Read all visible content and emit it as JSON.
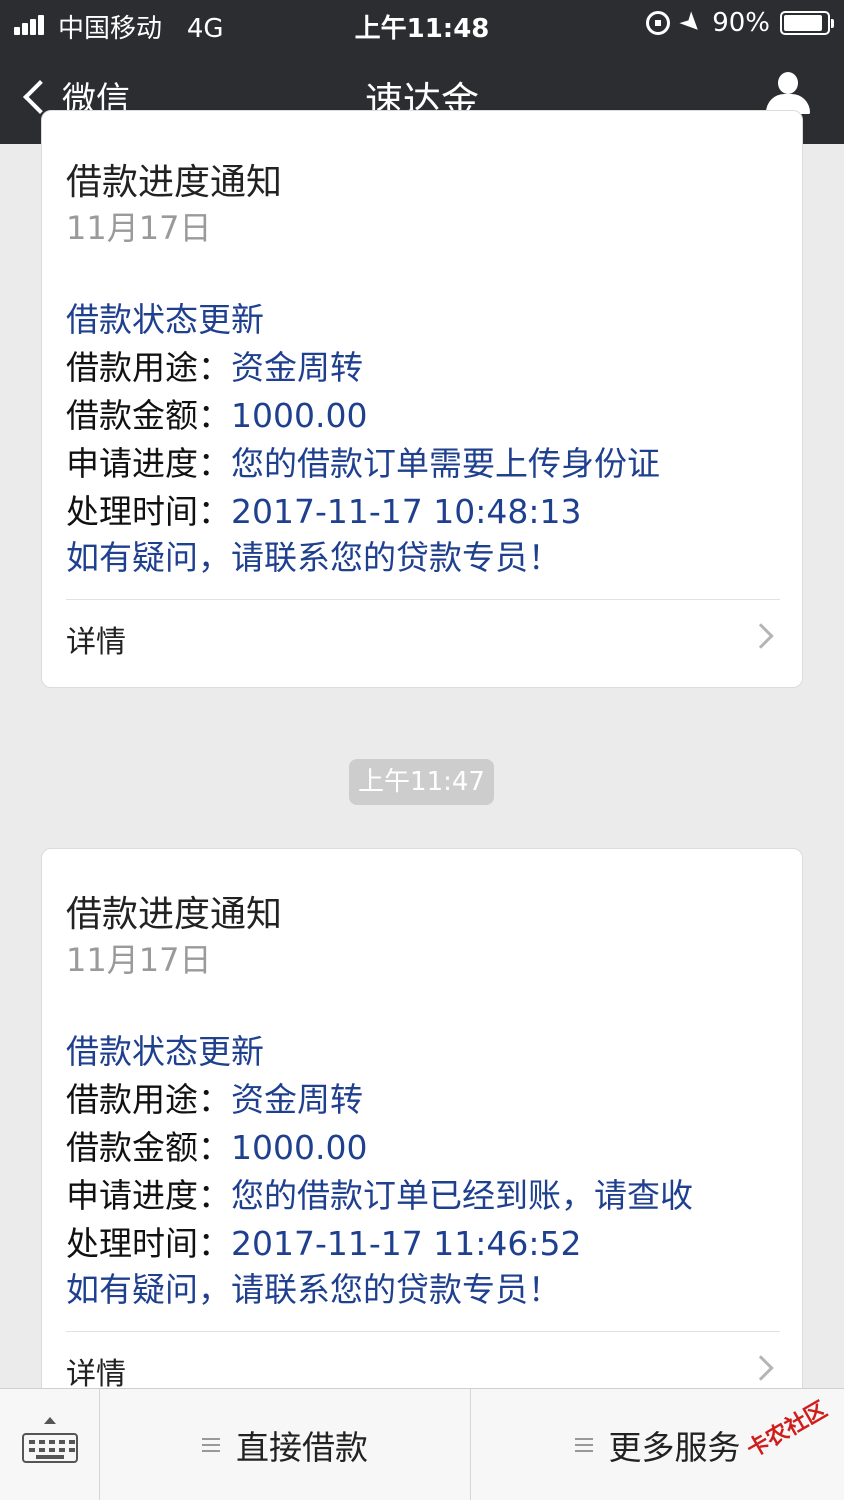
{
  "status_bar": {
    "carrier": "中国移动",
    "network": "4G",
    "time": "上午11:48",
    "battery_percent": "90%",
    "battery_level": 0.9
  },
  "nav": {
    "back_label": "微信",
    "title": "速达金"
  },
  "messages": [
    {
      "title": "借款进度通知",
      "date": "11月17日",
      "heading": "借款状态更新",
      "rows": [
        {
          "key": "借款用途：",
          "value": "资金周转"
        },
        {
          "key": "借款金额：",
          "value": "1000.00"
        },
        {
          "key": "申请进度：",
          "value": "您的借款订单需要上传身份证"
        },
        {
          "key": "处理时间：",
          "value": "2017-11-17 10:48:13"
        }
      ],
      "note": "如有疑问，请联系您的贷款专员！",
      "detail": "详情"
    },
    {
      "title": "借款进度通知",
      "date": "11月17日",
      "heading": "借款状态更新",
      "rows": [
        {
          "key": "借款用途：",
          "value": "资金周转"
        },
        {
          "key": "借款金额：",
          "value": "1000.00"
        },
        {
          "key": "申请进度：",
          "value": "您的借款订单已经到账，请查收"
        },
        {
          "key": "处理时间：",
          "value": "2017-11-17 11:46:52"
        }
      ],
      "note": "如有疑问，请联系您的贷款专员！",
      "detail": "详情"
    }
  ],
  "time_badge": "上午11:47",
  "bottom_menu": {
    "item1": "直接借款",
    "item2": "更多服务"
  },
  "watermark": "卡农社区",
  "colors": {
    "nav_bg": "#2c2d31",
    "link_blue": "#1f3f8f",
    "page_bg": "#ebebeb"
  }
}
